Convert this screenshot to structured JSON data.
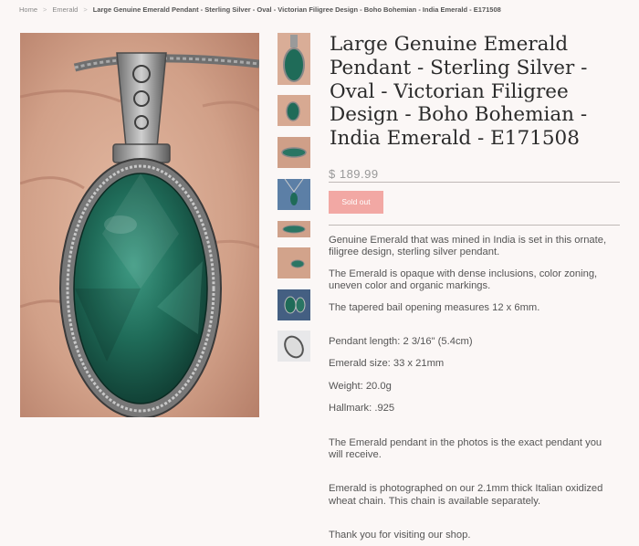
{
  "breadcrumb": {
    "home": "Home",
    "sep": ">",
    "category": "Emerald",
    "current": "Large Genuine Emerald Pendant - Sterling Silver - Oval - Victorian Filigree Design - Boho Bohemian - India Emerald - E171508"
  },
  "product": {
    "title": "Large Genuine Emerald Pendant - Sterling Silver - Oval - Victorian Filigree Design - Boho Bohemian - India Emerald - E171508",
    "price": "$ 189.99",
    "sold_out_label": "Sold out",
    "description": [
      "Genuine Emerald that was mined in India is set in this ornate, filigree design, sterling silver pendant.",
      "The Emerald is opaque with dense inclusions, color zoning, uneven color and organic markings.",
      "The tapered bail opening measures 12 x 6mm.",
      "Pendant length: 2 3/16\" (5.4cm)",
      "Emerald size: 33 x 21mm",
      "Weight: 20.0g",
      "Hallmark: .925",
      "The Emerald pendant in the photos is the exact pendant you will receive.",
      "Emerald is photographed on our 2.1mm thick Italian oxidized wheat chain. This chain is available separately.",
      "Thank you for visiting our shop."
    ]
  },
  "colors": {
    "background": "#fbf7f6",
    "sold_out_button": "#f2a8a4",
    "emerald": "#1f6b58"
  }
}
